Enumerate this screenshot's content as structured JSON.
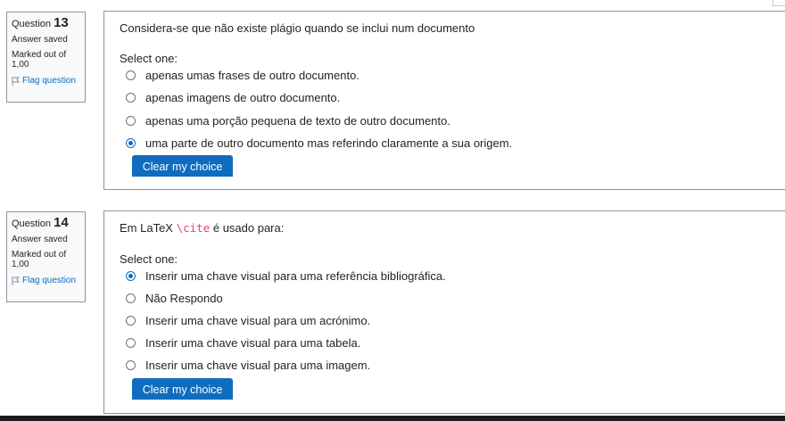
{
  "questions": [
    {
      "label": "Question",
      "number": "13",
      "state": "Answer saved",
      "grade": "Marked out of 1,00",
      "flag_label": "Flag question",
      "text": "Considera-se que não existe plágio quando se inclui num documento",
      "select_label": "Select one:",
      "options": [
        {
          "label": "apenas umas frases de outro documento.",
          "checked": false
        },
        {
          "label": "apenas imagens de outro documento.",
          "checked": false
        },
        {
          "label": "apenas uma porção pequena de texto de outro documento.",
          "checked": false
        },
        {
          "label": "uma parte de outro documento mas referindo claramente a sua origem.",
          "checked": true
        }
      ],
      "clear_label": "Clear my choice"
    },
    {
      "label": "Question",
      "number": "14",
      "state": "Answer saved",
      "grade": "Marked out of 1,00",
      "flag_label": "Flag question",
      "text_prefix": "Em LaTeX ",
      "text_code": "\\cite",
      "text_suffix": " é usado para:",
      "select_label": "Select one:",
      "options": [
        {
          "label": "Inserir uma chave visual para uma referência bibliográfica.",
          "checked": true
        },
        {
          "label": "Não Respondo",
          "checked": false
        },
        {
          "label": "Inserir uma chave visual para um acrónimo.",
          "checked": false
        },
        {
          "label": "Inserir uma chave visual para uma tabela.",
          "checked": false
        },
        {
          "label": "Inserir uma chave visual para uma imagem.",
          "checked": false
        }
      ],
      "clear_label": "Clear my choice"
    }
  ],
  "colors": {
    "accent": "#0f6cbf",
    "code": "#e83e8c",
    "border": "#8f959e"
  }
}
